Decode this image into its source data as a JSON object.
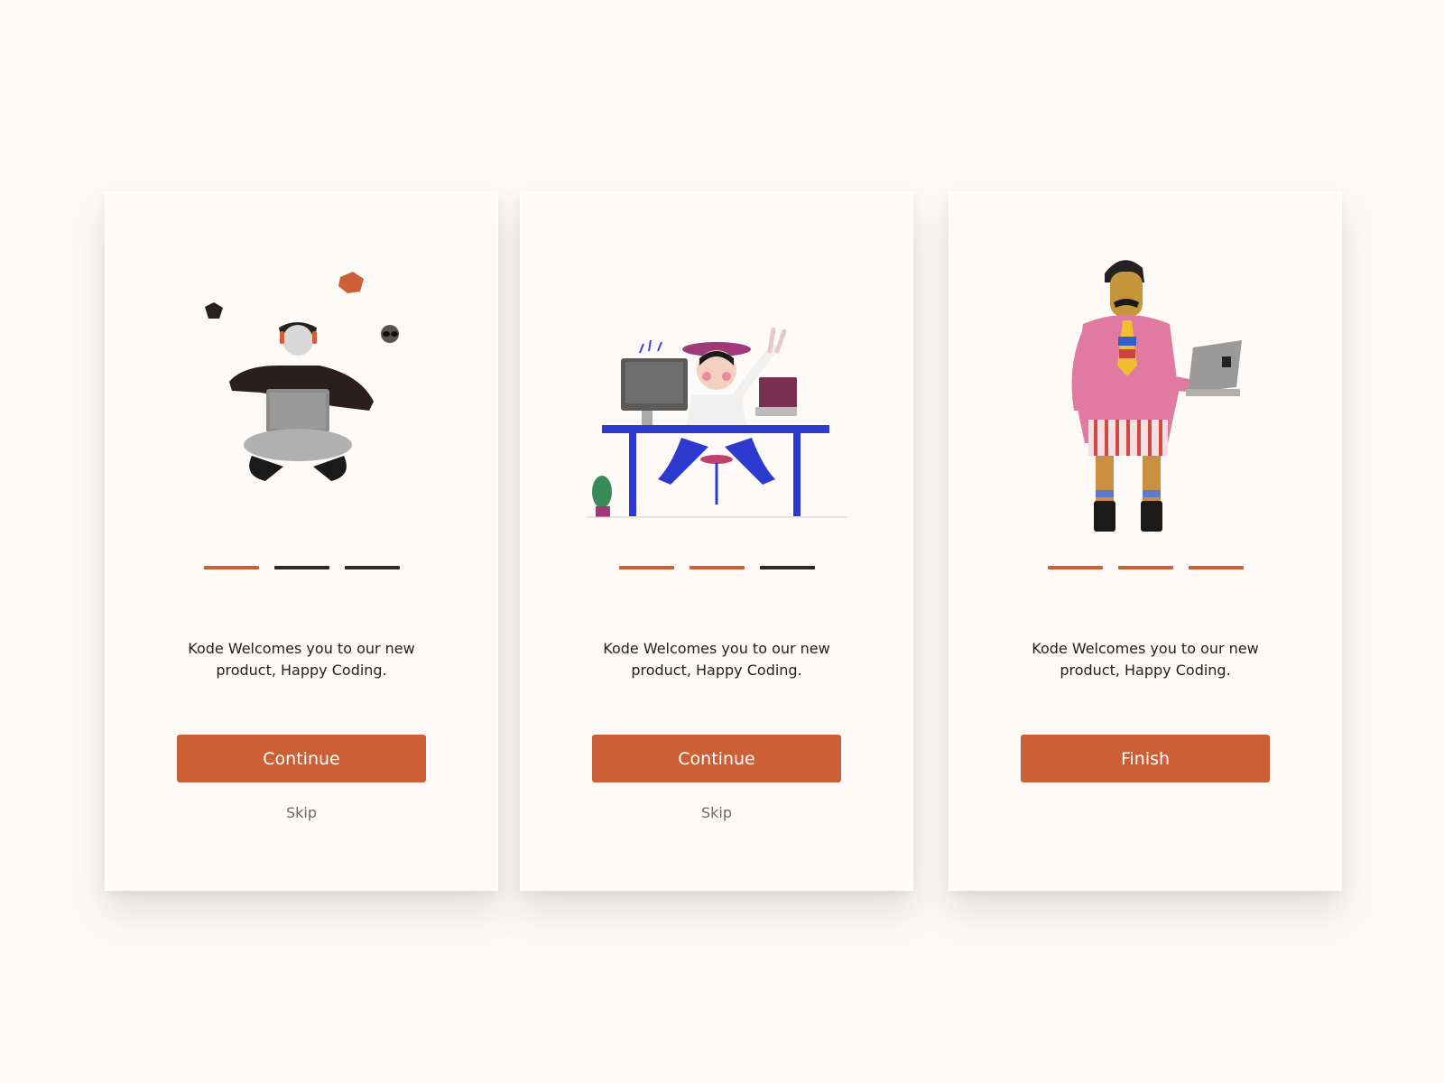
{
  "colors": {
    "accent": "#cc5f36",
    "inactive": "#2a2a2a",
    "background": "#fcf9f6"
  },
  "cards": [
    {
      "illustration": "person-sitting-cross-legged-with-laptop",
      "progress": {
        "total": 3,
        "active": 1
      },
      "message": "Kode Welcomes you to our new\nproduct, Happy Coding.",
      "button_label": "Continue",
      "skip_label": "Skip"
    },
    {
      "illustration": "person-at-desk-with-computer",
      "progress": {
        "total": 3,
        "active": 2
      },
      "message": "Kode Welcomes you to our new\nproduct, Happy Coding.",
      "button_label": "Continue",
      "skip_label": "Skip"
    },
    {
      "illustration": "man-holding-laptop",
      "progress": {
        "total": 3,
        "active": 3
      },
      "message": "Kode Welcomes you to our new\nproduct, Happy Coding.",
      "button_label": "Finish"
    }
  ]
}
